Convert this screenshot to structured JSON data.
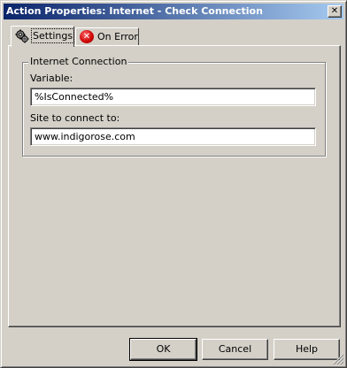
{
  "window": {
    "title": "Action Properties: Internet - Check Connection",
    "close_glyph": "✕"
  },
  "tabs": [
    {
      "label": "Settings",
      "icon": "settings-gears-icon",
      "active": true
    },
    {
      "label": "On Error",
      "icon": "error-icon",
      "active": false
    }
  ],
  "group": {
    "legend": "Internet Connection",
    "variable_label": "Variable:",
    "variable_value": "%IsConnected%",
    "site_label": "Site to connect to:",
    "site_value": "www.indigorose.com"
  },
  "buttons": {
    "ok": "OK",
    "cancel": "Cancel",
    "help": "Help"
  },
  "colors": {
    "titlebar_start": "#0a246a",
    "titlebar_end": "#a6caf0",
    "face": "#d4d0c8",
    "error_red": "#cc0000"
  }
}
